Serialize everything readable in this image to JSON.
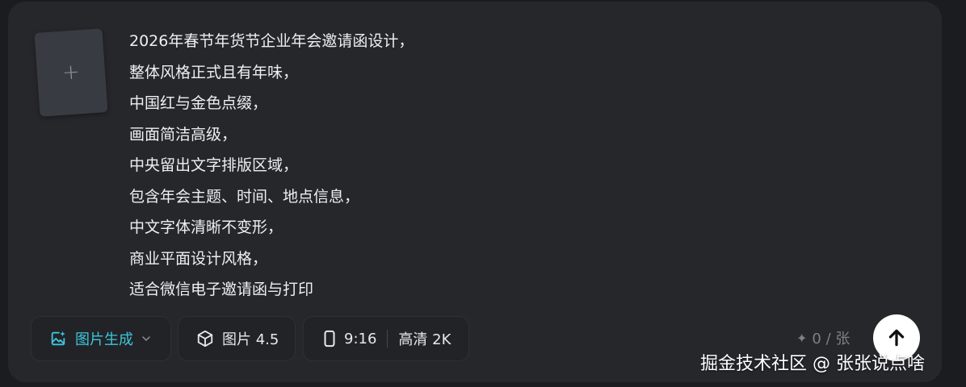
{
  "upload": {
    "icon": "plus-icon",
    "glyph": "+"
  },
  "prompt_lines": [
    "2026年春节年货节企业年会邀请函设计，",
    "整体风格正式且有年味，",
    "中国红与金色点缀，",
    "画面简洁高级，",
    "中央留出文字排版区域，",
    "包含年会主题、时间、地点信息，",
    "中文字体清晰不变形，",
    "商业平面设计风格，",
    "适合微信电子邀请函与打印"
  ],
  "toolbar": {
    "mode_label": "图片生成",
    "mode_icon": "image-sparkle-icon",
    "model_label": "图片 4.5",
    "model_icon": "cube-icon",
    "ratio_label": "9:16",
    "ratio_icon": "portrait-frame-icon",
    "quality_label": "高清 2K"
  },
  "counter": {
    "icon": "sparkle-icon",
    "text": "0 / 张"
  },
  "send": {
    "icon": "arrow-up-icon"
  },
  "watermark": "掘金技术社区 @ 张张说点啥",
  "colors": {
    "accent": "#3cc6dc",
    "panel": "#26272b",
    "text": "#eceff3"
  }
}
